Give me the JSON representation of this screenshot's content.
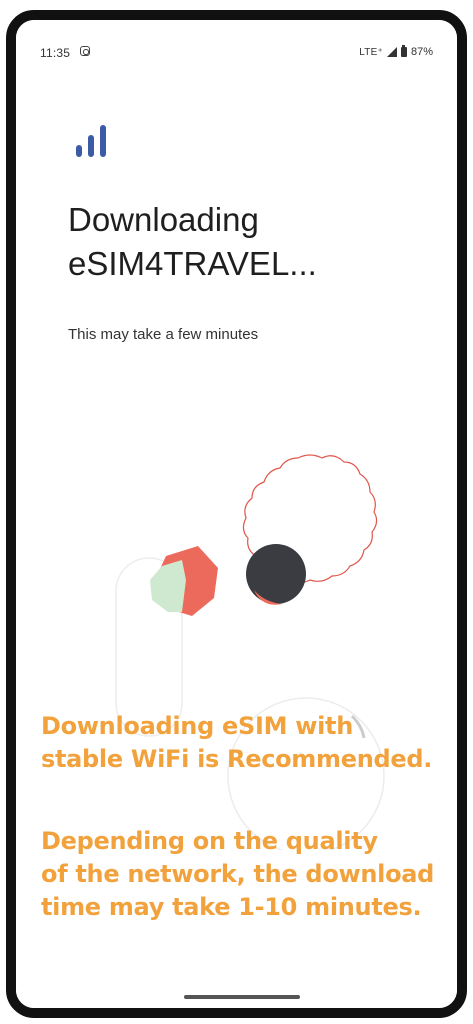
{
  "status_bar": {
    "time": "11:35",
    "network": "LTE⁺",
    "battery": "87%",
    "icons": [
      "instagram-icon",
      "signal-icon",
      "battery-icon"
    ]
  },
  "logo": {
    "icon": "signal-bars-icon",
    "color": "#3c5aa6"
  },
  "title_lines": [
    "Downloading",
    "eSIM4TRAVEL..."
  ],
  "subtitle": "This may take a few minutes",
  "notice": {
    "color": "#f2a23c",
    "paragraph_1": [
      "Downloading eSIM with",
      "stable WiFi is Recommended."
    ],
    "paragraph_2": [
      "Depending on the quality",
      "of the network, the download",
      "time may take 1-10 minutes."
    ]
  },
  "illustration": {
    "colors": {
      "coral": "#ec6a5c",
      "mint": "#cfe8d0",
      "dark": "#3a3c42",
      "outline": "#e5e5e5"
    }
  }
}
